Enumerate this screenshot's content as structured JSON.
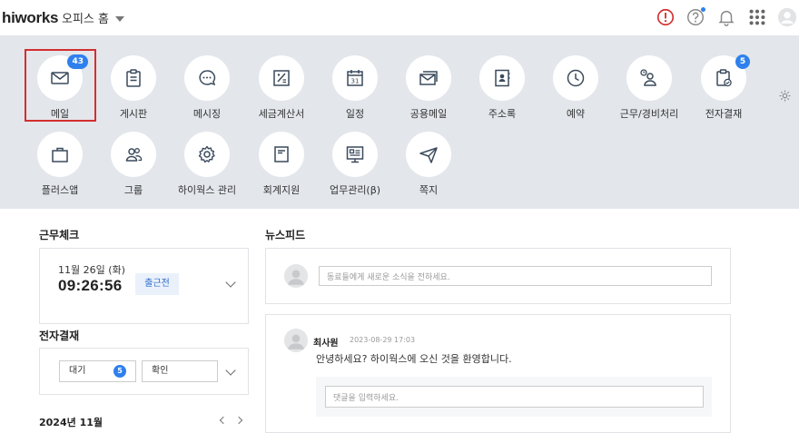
{
  "header": {
    "brand": "hiworks",
    "home_select": "오피스 홈",
    "icons": [
      "alert-icon",
      "help-icon",
      "bell-icon",
      "apps-grid-icon",
      "user-avatar-icon"
    ]
  },
  "apps": [
    {
      "label": "메일",
      "icon": "mail-icon",
      "badge": "43"
    },
    {
      "label": "게시판",
      "icon": "board-icon",
      "badge": ""
    },
    {
      "label": "메시징",
      "icon": "chat-icon",
      "badge": ""
    },
    {
      "label": "세금계산서",
      "icon": "tax-invoice-icon",
      "badge": ""
    },
    {
      "label": "일정",
      "icon": "calendar-icon",
      "badge": ""
    },
    {
      "label": "공용메일",
      "icon": "shared-mail-icon",
      "badge": ""
    },
    {
      "label": "주소록",
      "icon": "address-book-icon",
      "badge": ""
    },
    {
      "label": "예약",
      "icon": "clock-icon",
      "badge": ""
    },
    {
      "label": "근무/경비처리",
      "icon": "work-expense-icon",
      "badge": ""
    },
    {
      "label": "전자결재",
      "icon": "approval-icon",
      "badge": "5"
    },
    {
      "label": "플러스앱",
      "icon": "bag-icon",
      "badge": ""
    },
    {
      "label": "그룹",
      "icon": "group-icon",
      "badge": ""
    },
    {
      "label": "하이웍스 관리",
      "icon": "gear-icon",
      "badge": ""
    },
    {
      "label": "회계지원",
      "icon": "accounting-icon",
      "badge": ""
    },
    {
      "label": "업무관리(β)",
      "icon": "task-board-icon",
      "badge": ""
    },
    {
      "label": "쪽지",
      "icon": "note-plane-icon",
      "badge": ""
    }
  ],
  "attendance": {
    "title": "근무체크",
    "date": "11월 26일 (화)",
    "time": "09:26:56",
    "status": "출근전"
  },
  "approval": {
    "title": "전자결재",
    "filter_wait": "대기",
    "wait_count": "5",
    "filter_confirm": "확인"
  },
  "calendar": {
    "month": "2024년 11월"
  },
  "newsfeed": {
    "title": "뉴스피드",
    "compose_placeholder": "동료들에게 새로운 소식을 전하세요.",
    "post": {
      "author": "최사원",
      "date": "2023-08-29 17:03",
      "body": "안녕하세요? 하이웍스에 오신 것을 환영합니다.",
      "comment_placeholder": "댓글을 입력하세요."
    }
  },
  "colors": {
    "accent": "#2f80ed",
    "alert": "#d32f2f",
    "app_panel_bg": "#e3e6eb"
  }
}
